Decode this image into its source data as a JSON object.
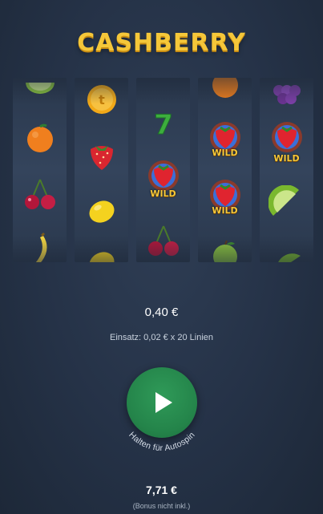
{
  "game": {
    "title": "CASHBERRY"
  },
  "reels": [
    {
      "symbols": [
        "lime-slice",
        "orange",
        "cherries",
        "banana"
      ]
    },
    {
      "symbols": [
        "gold-coin",
        "strawberry",
        "lemon",
        "lemon"
      ]
    },
    {
      "symbols": [
        "seven",
        "wild-berry",
        "cherries"
      ]
    },
    {
      "symbols": [
        "orange",
        "wild-berry",
        "wild-berry",
        "apple"
      ]
    },
    {
      "symbols": [
        "grapes",
        "wild-berry",
        "lime-slice",
        "lime-slice"
      ]
    }
  ],
  "symbol_text": {
    "coin": "t",
    "seven": "7",
    "wild": "WILD"
  },
  "bet": {
    "value": "0,40 €",
    "info": "Einsatz: 0,02 € x 20 Linien"
  },
  "spin": {
    "hold_label": "Halten für Autospin"
  },
  "balance": {
    "value": "7,71 €",
    "note": "(Bonus nicht inkl.)"
  },
  "colors": {
    "title": "#f5c739",
    "spin_button": "#24844a",
    "background": "#253247"
  }
}
